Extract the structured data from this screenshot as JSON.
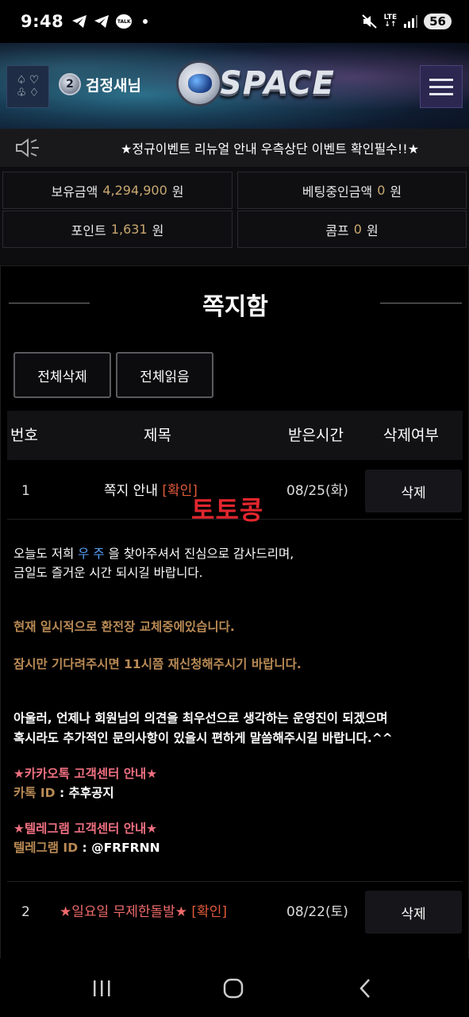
{
  "status_bar": {
    "time": "9:48",
    "network": "LTE",
    "battery": "56",
    "talk_badge": "TALK"
  },
  "header": {
    "suit_icons": [
      "♤",
      "♡",
      "♧",
      "♢"
    ],
    "level": "2",
    "username": "검정새님",
    "logo_text": "SPACE"
  },
  "notice": {
    "text": "★정규이벤트 리뉴얼 안내 우측상단 이벤트 확인필수!!★"
  },
  "balance": {
    "holding_label": "보유금액",
    "holding_value": "4,294,900",
    "betting_label": "베팅중인금액",
    "betting_value": "0",
    "point_label": "포인트",
    "point_value": "1,631",
    "comp_label": "콤프",
    "comp_value": "0",
    "unit": "원"
  },
  "inbox": {
    "title": "쪽지함",
    "delete_all": "전체삭제",
    "read_all": "전체읽음",
    "columns": [
      "번호",
      "제목",
      "받은시간",
      "삭제여부"
    ],
    "watermark": "토토콩",
    "rows": [
      {
        "no": "1",
        "subject": "쪽지 안내",
        "tag": "[확인]",
        "date": "08/25(화)",
        "delete": "삭제"
      },
      {
        "no": "2",
        "subject": "★일요일 무제한돌발★",
        "tag": "[확인]",
        "date": "08/22(토)",
        "delete": "삭제"
      }
    ],
    "message": {
      "line1_a": "오늘도 저희 ",
      "line1_brand": "우 주",
      "line1_b": " 을 찾아주셔서 진심으로 감사드리며,",
      "line2": "금일도 즐거운 시간 되시길 바랍니다.",
      "line3": "현재 일시적으로 환전장 교체중에있습니다.",
      "line4": "잠시만 기다려주시면 11시쯤 재신청해주시기 바랍니다.",
      "line5": "아울러, 언제나 회원님의 의견을 최우선으로 생각하는 운영진이 되겠으며",
      "line6": "혹시라도 추가적인 문의사항이 있을시 편하게 말씀해주시길 바랍니다.^^",
      "kakao_title": "★카카오톡 고객센터 안내★",
      "kakao_label": "카톡 ID",
      "kakao_value": " : 추후공지",
      "telegram_title": "★텔레그램 고객센터 안내★",
      "telegram_label": "텔레그램 ID",
      "telegram_value": " : @FRFRNN"
    }
  },
  "colors": {
    "gold": "#b98a55",
    "pink": "#f07080",
    "red": "#e2262e",
    "blue": "#5aa5ff"
  }
}
